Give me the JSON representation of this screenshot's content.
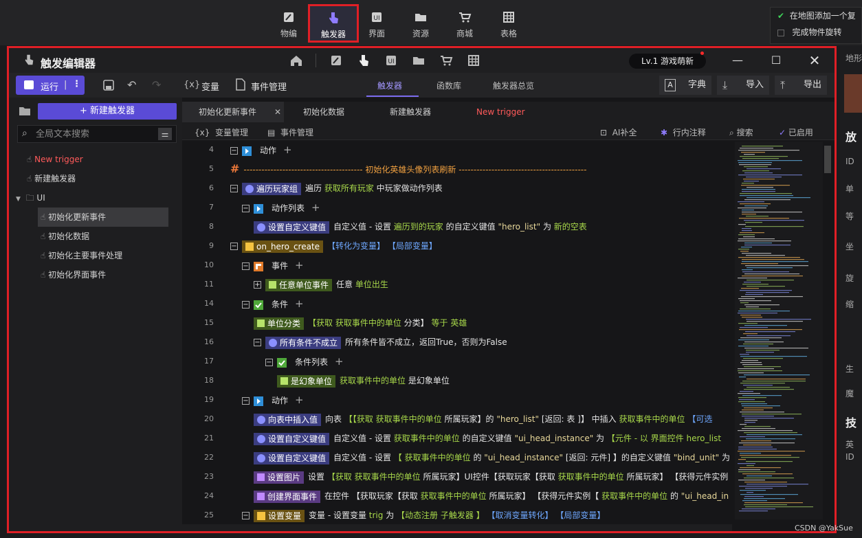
{
  "top_toolbar": {
    "items": [
      {
        "label": "物编",
        "icon": "edit-icon"
      },
      {
        "label": "触发器",
        "icon": "hand-pointer-icon",
        "active": true
      },
      {
        "label": "界面",
        "icon": "ui-icon"
      },
      {
        "label": "资源",
        "icon": "folder-icon"
      },
      {
        "label": "商城",
        "icon": "cart-icon"
      },
      {
        "label": "表格",
        "icon": "grid-icon"
      }
    ],
    "options": [
      {
        "label": "在地图添加一个复",
        "checked": true
      },
      {
        "label": "完成物件旋转",
        "checked": false
      }
    ]
  },
  "right_panel": {
    "header": "地形",
    "partial_texts": [
      "放",
      "ID",
      "单",
      "等",
      "坐",
      "旋",
      "缩",
      "生",
      "魔",
      "技",
      "英",
      "ID"
    ]
  },
  "editor": {
    "title": "触发编辑器",
    "level_badge": "Lv.1 游戏萌新",
    "toolbar": {
      "run_label": "运行",
      "variables_label": "变量",
      "event_manage_label": "事件管理",
      "variables_prefix": "{x}",
      "tabs": [
        {
          "label": "触发器",
          "active": true
        },
        {
          "label": "函数库"
        },
        {
          "label": "触发器总览"
        }
      ],
      "dictionary_label": "字典",
      "import_label": "导入",
      "export_label": "导出"
    },
    "sidebar": {
      "new_trigger_label": "+ 新建触发器",
      "search_placeholder": "全局文本搜索",
      "items": [
        {
          "label": "New trigger",
          "red": true,
          "indent": 0
        },
        {
          "label": "新建触发器",
          "indent": 0
        },
        {
          "label": "UI",
          "folder": true,
          "indent": 0
        },
        {
          "label": "初始化更新事件",
          "indent": 1,
          "selected": true
        },
        {
          "label": "初始化数据",
          "indent": 1
        },
        {
          "label": "初始化主要事件处理",
          "indent": 1
        },
        {
          "label": "初始化界面事件",
          "indent": 1
        }
      ]
    },
    "file_tabs": [
      {
        "label": "初始化更新事件",
        "active": true,
        "closable": true
      },
      {
        "label": "初始化数据"
      },
      {
        "label": "新建触发器"
      },
      {
        "label": "New trigger",
        "red": true
      }
    ],
    "subbar": {
      "var_manage": "变量管理",
      "event_manage": "事件管理",
      "ai_complete": "AI补全",
      "inline_comment": "行内注释",
      "search": "搜索",
      "enabled": "已启用"
    },
    "lines": [
      {
        "num": "4",
        "indent": 0,
        "parts": [
          [
            "box",
            "−"
          ],
          [
            "icon",
            "action"
          ],
          [
            "w",
            "动作"
          ],
          [
            "plus",
            "+"
          ]
        ]
      },
      {
        "num": "5",
        "indent": 0,
        "parts": [
          [
            "hash",
            "#"
          ],
          [
            "orange",
            "---------------------------------------- 初始化英雄头像列表刷新 -------------------------------------------"
          ]
        ]
      },
      {
        "num": "6",
        "indent": 0,
        "parts": [
          [
            "box",
            "−"
          ],
          [
            "tag-blue",
            "遍历玩家组"
          ],
          [
            "w",
            "遍历 "
          ],
          [
            "green",
            "获取所有玩家"
          ],
          [
            "w",
            " 中玩家做动作列表"
          ]
        ]
      },
      {
        "num": "7",
        "indent": 1,
        "parts": [
          [
            "box",
            "−"
          ],
          [
            "icon",
            "action"
          ],
          [
            "w",
            "动作列表"
          ],
          [
            "plus",
            "+"
          ]
        ]
      },
      {
        "num": "8",
        "indent": 2,
        "parts": [
          [
            "tag-blue",
            "设置自定义键值"
          ],
          [
            "w",
            "自定义值 - 设置 "
          ],
          [
            "green",
            "遍历到的玩家"
          ],
          [
            "w",
            " 的自定义键值 "
          ],
          [
            "str",
            "\"hero_list\""
          ],
          [
            "w",
            " 为 "
          ],
          [
            "green",
            "新的空表"
          ]
        ]
      },
      {
        "num": "9",
        "indent": 0,
        "parts": [
          [
            "box",
            "−"
          ],
          [
            "tag-yellow",
            "on_hero_create"
          ],
          [
            "blue",
            "【转化为变量】"
          ],
          [
            "blue",
            " 【局部变量】"
          ]
        ]
      },
      {
        "num": "10",
        "indent": 1,
        "parts": [
          [
            "box",
            "−"
          ],
          [
            "icon",
            "event"
          ],
          [
            "w",
            "事件"
          ],
          [
            "plus",
            "+"
          ]
        ]
      },
      {
        "num": "11",
        "indent": 2,
        "parts": [
          [
            "box",
            "+"
          ],
          [
            "tag-green",
            "任意单位事件"
          ],
          [
            "w",
            "任意 "
          ],
          [
            "green",
            "单位出生"
          ]
        ]
      },
      {
        "num": "14",
        "indent": 1,
        "parts": [
          [
            "box",
            "−"
          ],
          [
            "icon",
            "cond"
          ],
          [
            "w",
            "条件"
          ],
          [
            "plus",
            "+"
          ]
        ]
      },
      {
        "num": "15",
        "indent": 2,
        "parts": [
          [
            "tag-green",
            "单位分类"
          ],
          [
            "green",
            "【获取 "
          ],
          [
            "green",
            "获取事件中的单位"
          ],
          [
            "w",
            " 分类】"
          ],
          [
            "green",
            " 等于 "
          ],
          [
            "green",
            " 英雄"
          ]
        ]
      },
      {
        "num": "16",
        "indent": 2,
        "parts": [
          [
            "box",
            "−"
          ],
          [
            "tag-blue",
            "所有条件不成立"
          ],
          [
            "w",
            "所有条件皆不成立，返回True，否则为False"
          ]
        ]
      },
      {
        "num": "17",
        "indent": 3,
        "parts": [
          [
            "box",
            "−"
          ],
          [
            "icon",
            "cond"
          ],
          [
            "w",
            "条件列表"
          ],
          [
            "plus",
            "+"
          ]
        ]
      },
      {
        "num": "18",
        "indent": 4,
        "parts": [
          [
            "tag-green",
            "是幻象单位"
          ],
          [
            "green",
            "获取事件中的单位"
          ],
          [
            "w",
            " 是幻象单位"
          ]
        ]
      },
      {
        "num": "19",
        "indent": 1,
        "parts": [
          [
            "box",
            "−"
          ],
          [
            "icon",
            "action"
          ],
          [
            "w",
            "动作"
          ],
          [
            "plus",
            "+"
          ]
        ]
      },
      {
        "num": "20",
        "indent": 2,
        "parts": [
          [
            "tag-blue",
            "向表中插入值"
          ],
          [
            "w",
            "向表 "
          ],
          [
            "green",
            "【【获取 "
          ],
          [
            "green",
            "获取事件中的单位"
          ],
          [
            "w",
            " 所属玩家】的 "
          ],
          [
            "str",
            "\"hero_list\""
          ],
          [
            "w",
            " [返回: 表 ]】"
          ],
          [
            "w",
            " 中插入 "
          ],
          [
            "green",
            "获取事件中的单位"
          ],
          [
            "blue",
            "  【可选"
          ]
        ]
      },
      {
        "num": "21",
        "indent": 2,
        "parts": [
          [
            "tag-blue",
            "设置自定义键值"
          ],
          [
            "w",
            "自定义值 - 设置 "
          ],
          [
            "green",
            "获取事件中的单位"
          ],
          [
            "w",
            " 的自定义键值 "
          ],
          [
            "str",
            "\"ui_head_instance\""
          ],
          [
            "w",
            " 为 "
          ],
          [
            "green",
            "【元件 - 以 "
          ],
          [
            "green",
            "界面控件 hero_list "
          ]
        ]
      },
      {
        "num": "22",
        "indent": 2,
        "parts": [
          [
            "tag-blue",
            "设置自定义键值"
          ],
          [
            "w",
            "自定义值 - 设置 "
          ],
          [
            "green",
            "【 获取事件中的单位"
          ],
          [
            "w",
            " 的 "
          ],
          [
            "str",
            "\"ui_head_instance\""
          ],
          [
            "w",
            " [返回: 元件] 】的自定义键值 "
          ],
          [
            "str",
            "\"bind_unit\""
          ],
          [
            "w",
            " 为"
          ]
        ]
      },
      {
        "num": "23",
        "indent": 2,
        "parts": [
          [
            "tag-purple",
            "设置图片"
          ],
          [
            "w",
            "设置 "
          ],
          [
            "green",
            "【获取 "
          ],
          [
            "green",
            "获取事件中的单位"
          ],
          [
            "w",
            " 所属玩家】UI控件【获取玩家【获取 "
          ],
          [
            "green",
            "获取事件中的单位"
          ],
          [
            "w",
            " 所属玩家】 【获得元件实例"
          ]
        ]
      },
      {
        "num": "24",
        "indent": 2,
        "parts": [
          [
            "tag-purple",
            "创建界面事件"
          ],
          [
            "w",
            "在控件 【获取玩家【获取 "
          ],
          [
            "green",
            "获取事件中的单位"
          ],
          [
            "w",
            " 所属玩家】 【获得元件实例【 "
          ],
          [
            "green",
            "获取事件中的单位"
          ],
          [
            "w",
            " 的 "
          ],
          [
            "str",
            "\"ui_head_in"
          ]
        ]
      },
      {
        "num": "25",
        "indent": 1,
        "parts": [
          [
            "box",
            "−"
          ],
          [
            "tag-yellow",
            "设置变量"
          ],
          [
            "w",
            "变量 - 设置变量 "
          ],
          [
            "green",
            "trig"
          ],
          [
            "w",
            " 为 "
          ],
          [
            "green",
            "【动态注册 "
          ],
          [
            "green",
            "子触发器"
          ],
          [
            "green",
            " 】"
          ],
          [
            "blue",
            " 【取消变量转化】"
          ],
          [
            "blue",
            " 【局部变量】"
          ]
        ]
      }
    ]
  },
  "watermark": "CSDN @YakSue",
  "colors": {
    "accent": "#5a4bd6",
    "highlight_red": "#e01f26",
    "keyword_green": "#a8d84a",
    "keyword_blue": "#6fa8ff"
  }
}
